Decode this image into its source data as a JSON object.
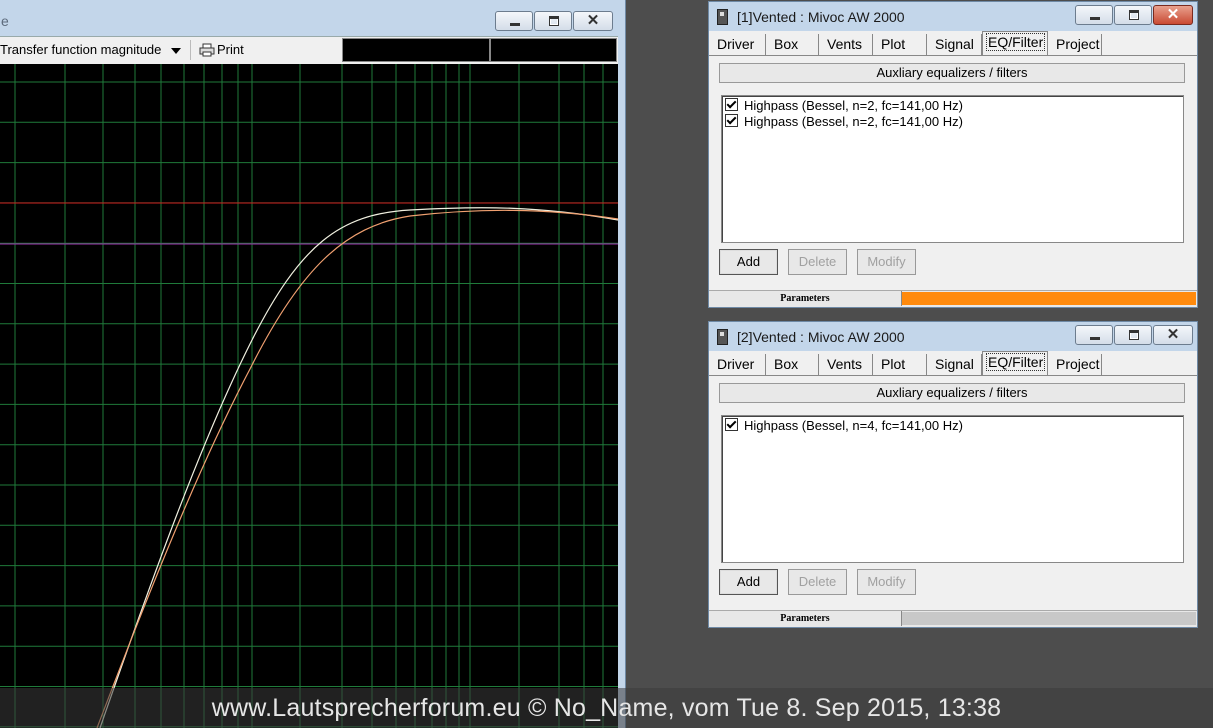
{
  "plot_window": {
    "title": "e",
    "plot_select": "Transfer function magnitude",
    "print_label": "Print"
  },
  "dialog1": {
    "title": "[1]Vented : Mivoc AW 2000",
    "tabs": [
      "Driver",
      "Box",
      "Vents",
      "Plot",
      "Signal",
      "EQ/Filter",
      "Project"
    ],
    "active_tab": "EQ/Filter",
    "group_label": "Auxliary equalizers / filters",
    "filters": [
      {
        "label": "Highpass (Bessel, n=2, fc=141,00 Hz)",
        "checked": true
      },
      {
        "label": "Highpass (Bessel, n=2, fc=141,00 Hz)",
        "checked": true
      }
    ],
    "buttons": {
      "add": "Add",
      "delete": "Delete",
      "modify": "Modify"
    },
    "status_label": "Parameters",
    "progress_color": "#ff8a0d",
    "progress": 1.0
  },
  "dialog2": {
    "title": "[2]Vented : Mivoc AW 2000",
    "tabs": [
      "Driver",
      "Box",
      "Vents",
      "Plot",
      "Signal",
      "EQ/Filter",
      "Project"
    ],
    "active_tab": "EQ/Filter",
    "group_label": "Auxliary equalizers / filters",
    "filters": [
      {
        "label": "Highpass (Bessel, n=4, fc=141,00 Hz)",
        "checked": true
      }
    ],
    "buttons": {
      "add": "Add",
      "delete": "Delete",
      "modify": "Modify"
    },
    "status_label": "Parameters",
    "progress_color": "#c8c8c8",
    "progress": 0.0
  },
  "watermark": "www.Lautsprecherforum.eu © No_Name, vom Tue 8. Sep 2015, 13:38",
  "colors": {
    "grid": "#1f7a3a",
    "ref_line_red": "#d02020",
    "ref_line_magenta": "#a030b0",
    "curve_white": "#f0f0e0",
    "curve_orange": "#f0a070"
  }
}
